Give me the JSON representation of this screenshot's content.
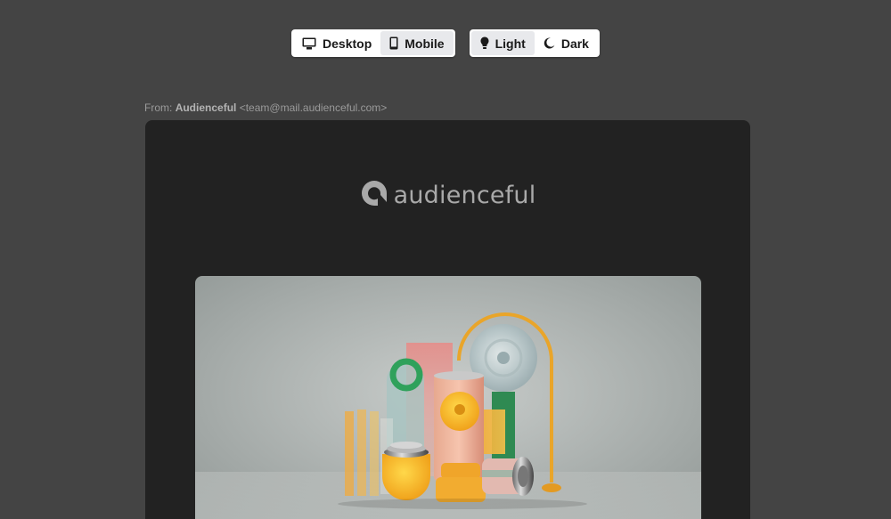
{
  "toolbar": {
    "view_options": [
      {
        "label": "Desktop",
        "icon": "desktop-icon",
        "active": false
      },
      {
        "label": "Mobile",
        "icon": "mobile-icon",
        "active": true
      }
    ],
    "theme_options": [
      {
        "label": "Light",
        "icon": "lightbulb-icon",
        "active": true
      },
      {
        "label": "Dark",
        "icon": "moon-icon",
        "active": false
      }
    ]
  },
  "sender": {
    "prefix": "From:",
    "name": "Audienceful",
    "address": "<team@mail.audienceful.com>"
  },
  "email": {
    "logo_text": "audienceful",
    "hero_image": "3d-abstract-shapes-illustration"
  },
  "colors": {
    "page_bg": "#444444",
    "email_bg": "#222222",
    "active_segment": "#e8e9ec"
  }
}
